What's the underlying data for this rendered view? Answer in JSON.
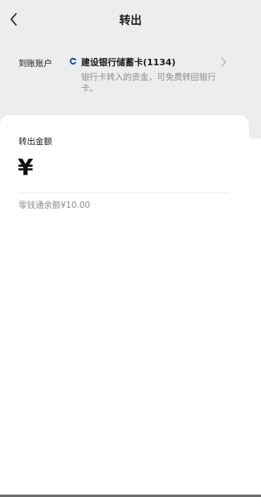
{
  "header": {
    "title": "转出"
  },
  "account": {
    "label": "到账账户",
    "bank_name": "建设银行储蓄卡(1134)",
    "description": "银行卡转入的资金，可免费转回银行卡。"
  },
  "amount": {
    "label": "转出金额",
    "currency_symbol": "¥",
    "balance_text": "零钱通余额¥10.00"
  },
  "colors": {
    "header_bg": "#ededed",
    "card_bg": "#ffffff",
    "muted_text": "#8c8c8c",
    "bank_logo": "#1e5aa8"
  },
  "icons": {
    "back": "chevron-left-icon",
    "bank": "ccb-bank-logo-icon",
    "forward": "chevron-right-icon"
  }
}
